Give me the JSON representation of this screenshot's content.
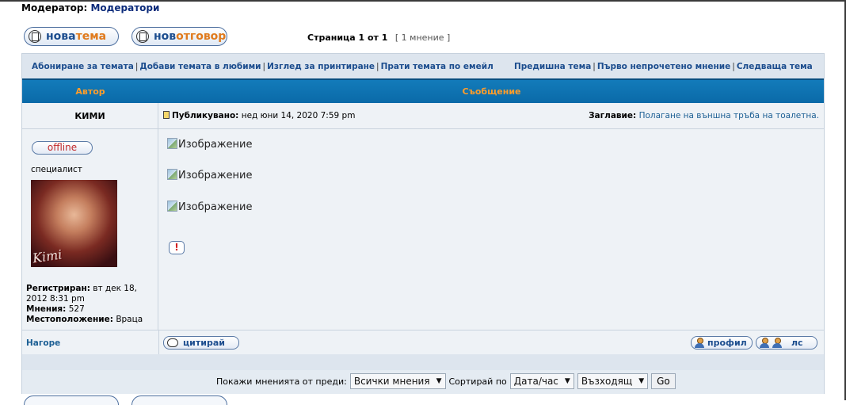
{
  "moderator": {
    "label": "Модератор:",
    "name": "Модератори"
  },
  "buttons": {
    "new_topic": {
      "w1": "нова",
      "w2": "тема"
    },
    "new_reply": {
      "w1": "нов",
      "w2": "отговор"
    }
  },
  "pager": {
    "text": "Страница 1 от 1",
    "count": "[ 1 мнение ]"
  },
  "links_left": [
    "Абониране за темата",
    "Добави темата в любими",
    "Изглед за принтиране",
    "Прати темата по емейл"
  ],
  "links_right": [
    "Предишна тема",
    "Първо непрочетено мнение",
    "Следваща тема"
  ],
  "table_head": {
    "author": "Автор",
    "message": "Съобщение"
  },
  "post": {
    "author": "КИМИ",
    "posted_label": "Публикувано:",
    "posted_value": "нед юни 14, 2020 7:59 pm",
    "subject_label": "Заглавие:",
    "subject_value": "Полагане на външна тръба на тоалетна.",
    "status": "offline",
    "rank": "специалист",
    "avatar_signature": "Kimi",
    "registered_label": "Регистриран:",
    "registered_value": "вт дек 18, 2012 8:31 pm",
    "posts_label": "Мнения:",
    "posts_value": "527",
    "location_label": "Местоположение:",
    "location_value": "Враца",
    "images": [
      "Изображение",
      "Изображение",
      "Изображение"
    ],
    "report_symbol": "!"
  },
  "post_actions": {
    "top": "Нагоре",
    "quote": "цитирай",
    "profile": "профил",
    "pm": "лс"
  },
  "sort": {
    "show_label": "Покажи мненията от преди:",
    "show_value": "Всички мнения",
    "sort_label": "Сортирай по",
    "sort_value": "Дата/час",
    "order_value": "Възходящ",
    "go": "Go"
  }
}
